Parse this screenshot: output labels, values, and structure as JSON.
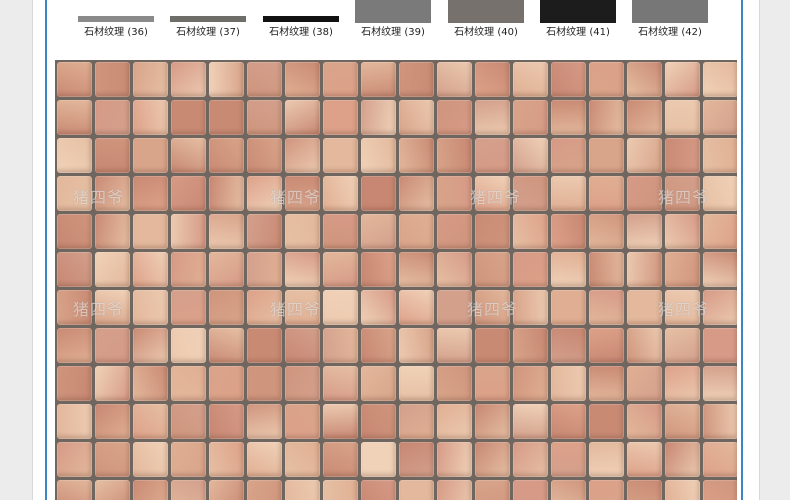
{
  "swatches": [
    {
      "label": "石材纹理 (36)",
      "color": "#8a8a8a",
      "style": "thin"
    },
    {
      "label": "石材纹理 (37)",
      "color": "#6f6d68",
      "style": "thin"
    },
    {
      "label": "石材纹理 (38)",
      "color": "#111111",
      "style": "thin"
    },
    {
      "label": "石材纹理 (39)",
      "color": "#7a7a7a",
      "style": "full"
    },
    {
      "label": "石材纹理 (40)",
      "color": "#76716c",
      "style": "full"
    },
    {
      "label": "石材纹理 (41)",
      "color": "#1c1c1c",
      "style": "full"
    },
    {
      "label": "石材纹理 (42)",
      "color": "#777777",
      "style": "full"
    }
  ],
  "watermarks": [
    "猪四爷",
    "猪四爷",
    "猪四爷",
    "猪四爷",
    "猪四爷",
    "猪四爷",
    "猪四爷",
    "猪四爷"
  ],
  "tile_colors": [
    "#d8a48a",
    "#e3b89c",
    "#cf957d",
    "#eccab0",
    "#d69a86",
    "#c98a74",
    "#e0af93",
    "#f0d2b8",
    "#d3a08c",
    "#c78772",
    "#e6c0a4",
    "#dda189"
  ],
  "mosaic": {
    "columns": 18,
    "rows": 12
  }
}
